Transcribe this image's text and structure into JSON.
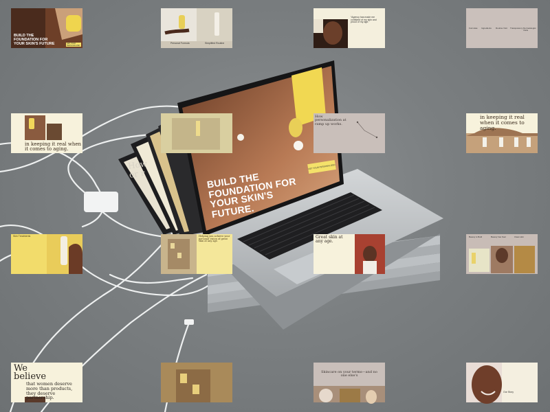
{
  "cards": {
    "r1c1": {
      "headline": "BUILD THE FOUNDATION FOR YOUR SKIN'S FUTURE",
      "button": "GET YOUR PERSONALIZED"
    },
    "r1c2": {
      "left_caption": "Personal Formula",
      "right_caption": "Simplified Routine"
    },
    "r1c3": {
      "quote": "“Agency has made me confident of my skin and proud of my age.”"
    },
    "r1c4": {
      "col1": "Formulas",
      "col2": "Ingredients",
      "col3": "Routine Visit",
      "col4": "Transparency",
      "col5": "Dermatologist Visits"
    },
    "r2c1": {
      "headline": "in keeping it real when it comes to aging."
    },
    "r2c3": {
      "headline": "How personalization at ramp up works."
    },
    "r2c4": {
      "headline": "in keeping it real when it comes to aging."
    },
    "r3c1": {
      "label": "Skin Treatments"
    },
    "r3c2": {
      "headline": "Helping you achieve your personal vision of great skin at any age."
    },
    "r3c3": {
      "headline": "Great skin at any age."
    },
    "r3c4": {
      "col1": "Beauty is Bold",
      "col2": "Beauty has Soul",
      "col3": "Clean skin"
    },
    "r4c1": {
      "line1": "We",
      "line2": "believe",
      "body": "that women deserve more than products, they deserve partnership."
    },
    "r4c3": {
      "headline": "Skincare on your terms—and no one else's"
    },
    "r4c4": {
      "label": "Our Story"
    }
  },
  "laptop": {
    "headline": "BUILD THE FOUNDATION FOR YOUR SKIN'S FUTURE.",
    "cta": "GET YOUR PERSONALIZED",
    "back_text": "How\nor r"
  },
  "colors": {
    "background": "#7b7f81",
    "cream": "#f7f2dc",
    "yellow": "#f4e16a",
    "taupe": "#c8bcb6",
    "silver": "#b9bdc0"
  }
}
